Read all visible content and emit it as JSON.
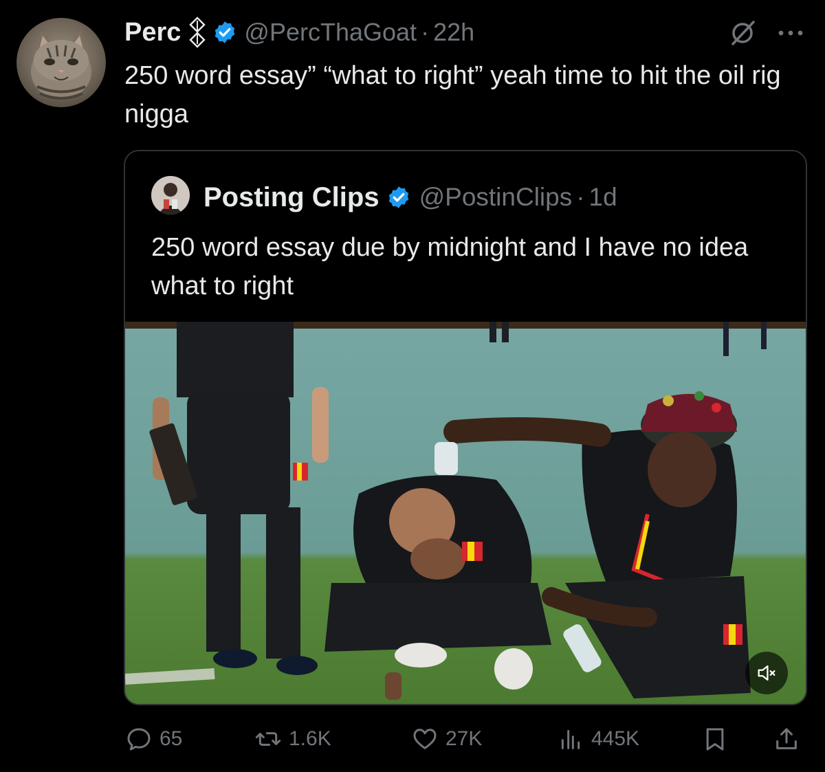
{
  "tweet": {
    "author": {
      "display_name": "Perc",
      "handle": "@PercThaGoat",
      "time": "22h",
      "avatar_icon": "cat-avatar",
      "badge_icon": "sigil-tag-icon",
      "verified_color": "#1d9bf0"
    },
    "text": "250 word essay” “what to right” yeah time to hit the oil rig nigga",
    "top_icons": [
      "grok-icon",
      "more-icon"
    ]
  },
  "quoted": {
    "author": {
      "display_name": "Posting Clips",
      "handle": "@PostinClips",
      "time": "1d",
      "avatar_icon": "person-avatar"
    },
    "text": "250 word essay due by midnight and I have no idea what to right",
    "media": {
      "type": "video",
      "muted": true,
      "mute_icon": "speaker-muted-icon"
    }
  },
  "actions": {
    "reply": {
      "icon": "reply-icon",
      "count": "65"
    },
    "retweet": {
      "icon": "retweet-icon",
      "count": "1.6K"
    },
    "like": {
      "icon": "heart-icon",
      "count": "27K"
    },
    "views": {
      "icon": "views-icon",
      "count": "445K"
    },
    "bookmark": {
      "icon": "bookmark-icon"
    },
    "share": {
      "icon": "share-icon"
    }
  },
  "colors": {
    "background": "#000000",
    "text": "#e7e9ea",
    "secondary": "#71767b",
    "border": "#2f3336",
    "accent": "#1d9bf0"
  }
}
